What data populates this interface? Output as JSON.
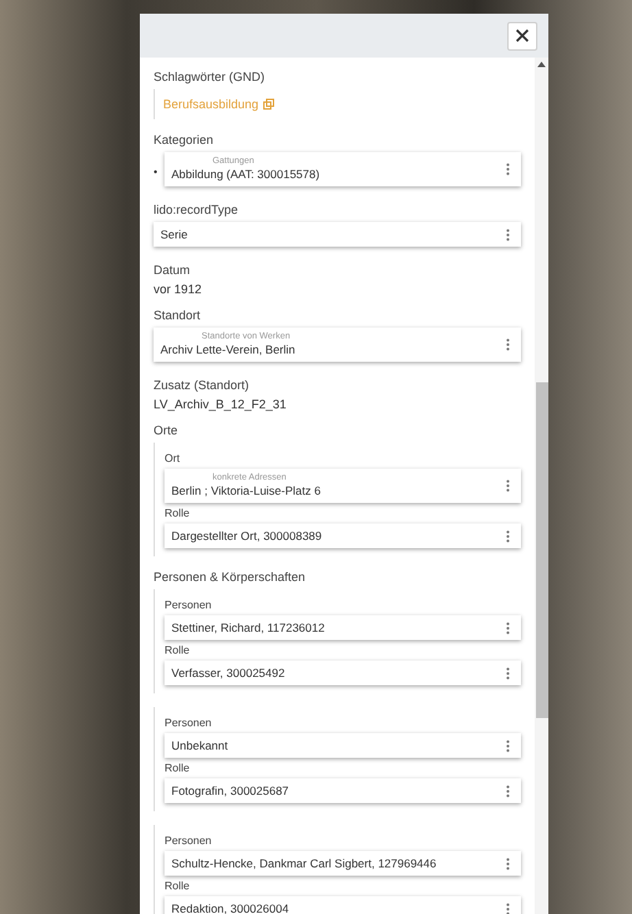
{
  "sections": [
    {
      "kind": "links",
      "label": "Schlagwörter (GND)",
      "links": [
        "Berufsausbildung"
      ]
    },
    {
      "kind": "fields",
      "label": "Kategorien",
      "fields": [
        {
          "bullet": "•",
          "caption": "Gattungen",
          "value": "Abbildung (AAT: 300015578)"
        }
      ]
    },
    {
      "kind": "fields",
      "label": "lido:recordType",
      "fields": [
        {
          "value": "Serie"
        }
      ]
    },
    {
      "kind": "text",
      "label": "Datum",
      "value": "vor 1912"
    },
    {
      "kind": "fields",
      "label": "Standort",
      "fields": [
        {
          "caption": "Standorte von Werken",
          "value": "Archiv Lette-Verein, Berlin"
        }
      ]
    },
    {
      "kind": "text",
      "label": "Zusatz (Standort)",
      "value": "LV_Archiv_B_12_F2_31"
    },
    {
      "kind": "groups",
      "label": "Orte",
      "groups": [
        [
          {
            "label": "Ort",
            "caption": "konkrete Adressen",
            "value": "Berlin ; Viktoria-Luise-Platz 6"
          },
          {
            "label": "Rolle",
            "value": "Dargestellter Ort, 300008389"
          }
        ]
      ]
    },
    {
      "kind": "groups",
      "label": "Personen & Körperschaften",
      "groups": [
        [
          {
            "label": "Personen",
            "value": "Stettiner, Richard, 117236012"
          },
          {
            "label": "Rolle",
            "value": "Verfasser, 300025492"
          }
        ],
        [
          {
            "label": "Personen",
            "value": "Unbekannt"
          },
          {
            "label": "Rolle",
            "value": "Fotografin, 300025687"
          }
        ],
        [
          {
            "label": "Personen",
            "value": "Schultz-Hencke, Dankmar Carl Sigbert, 127969446"
          },
          {
            "label": "Rolle",
            "value": "Redaktion, 300026004"
          }
        ]
      ]
    }
  ]
}
